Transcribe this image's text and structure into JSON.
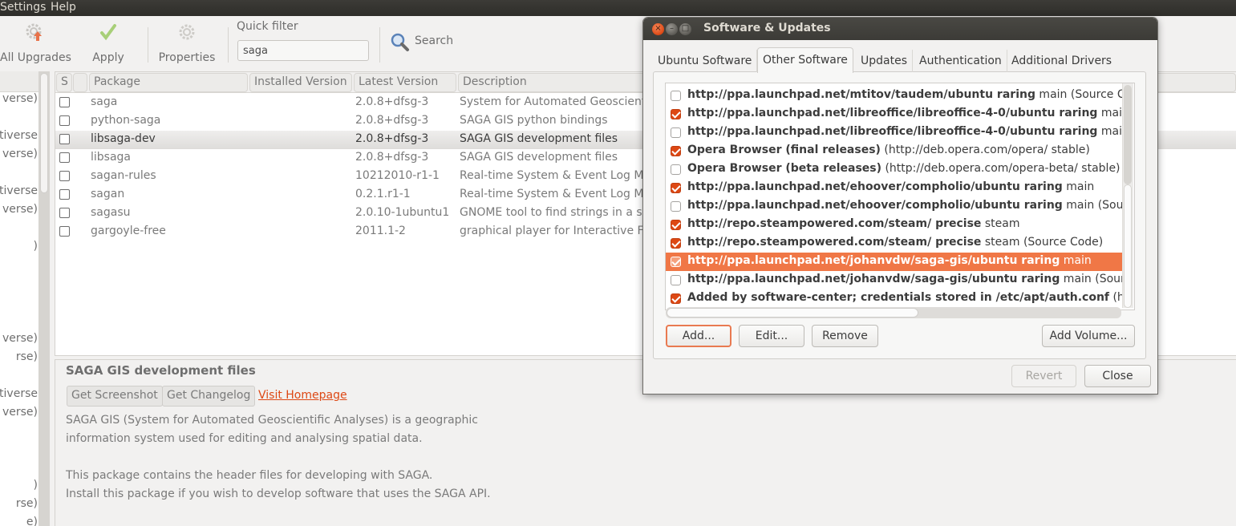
{
  "menubar": {
    "items": [
      "Settings",
      "Help"
    ]
  },
  "toolbar": {
    "all_upgrades": "All Upgrades",
    "apply": "Apply",
    "properties": "Properties",
    "quick_filter_label": "Quick filter",
    "quick_filter_value": "saga",
    "search": "Search"
  },
  "sidebar": {
    "items": [
      "verse)",
      "ltiverse",
      "verse)",
      "ltiverse",
      "verse)",
      ")",
      "verse)",
      "rse)",
      "ltiverse",
      "verse)",
      ")",
      "rse)",
      "e)"
    ]
  },
  "package_table": {
    "columns": [
      "S",
      "",
      "Package",
      "Installed Version",
      "Latest Version",
      "Description"
    ],
    "rows": [
      {
        "checked": false,
        "package": "saga",
        "installed": "",
        "latest": "2.0.8+dfsg-3",
        "description": "System for Automated Geoscientific Analyses"
      },
      {
        "checked": false,
        "package": "python-saga",
        "installed": "",
        "latest": "2.0.8+dfsg-3",
        "description": "SAGA GIS python bindings"
      },
      {
        "checked": false,
        "package": "libsaga-dev",
        "installed": "",
        "latest": "2.0.8+dfsg-3",
        "description": "SAGA GIS development files",
        "selected": true
      },
      {
        "checked": false,
        "package": "libsaga",
        "installed": "",
        "latest": "2.0.8+dfsg-3",
        "description": "SAGA GIS development files"
      },
      {
        "checked": false,
        "package": "sagan-rules",
        "installed": "",
        "latest": "10212010-r1-1",
        "description": "Real-time System & Event Log Monitoring"
      },
      {
        "checked": false,
        "package": "sagan",
        "installed": "",
        "latest": "0.2.1.r1-1",
        "description": "Real-time System & Event Log Monitoring"
      },
      {
        "checked": false,
        "package": "sagasu",
        "installed": "",
        "latest": "2.0.10-1ubuntu1",
        "description": "GNOME tool to find strings in a set of files"
      },
      {
        "checked": false,
        "package": "gargoyle-free",
        "installed": "",
        "latest": "2011.1-2",
        "description": "graphical player for Interactive Fiction"
      }
    ]
  },
  "details": {
    "title": "SAGA GIS development files",
    "get_screenshot": "Get Screenshot",
    "get_changelog": "Get Changelog",
    "visit_homepage": "Visit Homepage",
    "paragraphs": [
      "SAGA GIS (System for Automated Geoscientific Analyses) is a geographic",
      "information system used for editing and analysing spatial data.",
      "",
      "This package contains the header files for developing with SAGA.",
      "Install this package if you wish to develop software that uses the SAGA API."
    ]
  },
  "dialog": {
    "title": "Software & Updates",
    "tabs": [
      "Ubuntu Software",
      "Other Software",
      "Updates",
      "Authentication",
      "Additional Drivers"
    ],
    "active_tab": "Other Software",
    "sources": [
      {
        "checked": false,
        "bold": "http://ppa.launchpad.net/mtitov/taudem/ubuntu raring",
        "rest": " main (Source Code)"
      },
      {
        "checked": true,
        "bold": "http://ppa.launchpad.net/libreoffice/libreoffice-4-0/ubuntu raring",
        "rest": " main"
      },
      {
        "checked": false,
        "bold": "http://ppa.launchpad.net/libreoffice/libreoffice-4-0/ubuntu raring",
        "rest": " main (Source Code)"
      },
      {
        "checked": true,
        "bold": "Opera Browser (final releases)",
        "rest": " (http://deb.opera.com/opera/ stable)"
      },
      {
        "checked": false,
        "bold": "Opera Browser (beta releases)",
        "rest": " (http://deb.opera.com/opera-beta/ stable)"
      },
      {
        "checked": true,
        "bold": "http://ppa.launchpad.net/ehoover/compholio/ubuntu raring",
        "rest": " main"
      },
      {
        "checked": false,
        "bold": "http://ppa.launchpad.net/ehoover/compholio/ubuntu raring",
        "rest": " main (Source Code)"
      },
      {
        "checked": true,
        "bold": "http://repo.steampowered.com/steam/ precise",
        "rest": " steam"
      },
      {
        "checked": true,
        "bold": "http://repo.steampowered.com/steam/ precise",
        "rest": " steam (Source Code)"
      },
      {
        "checked": true,
        "bold": "http://ppa.launchpad.net/johanvdw/saga-gis/ubuntu raring",
        "rest": " main",
        "selected": true
      },
      {
        "checked": false,
        "bold": "http://ppa.launchpad.net/johanvdw/saga-gis/ubuntu raring",
        "rest": " main (Source Code)"
      },
      {
        "checked": true,
        "bold": "Added by software-center; credentials stored in /etc/apt/auth.conf",
        "rest": " (https://p"
      }
    ],
    "buttons": {
      "add": "Add...",
      "edit": "Edit...",
      "remove": "Remove",
      "add_volume": "Add Volume...",
      "revert": "Revert",
      "close": "Close"
    },
    "accent_color": "#dd4814",
    "selection_color": "#f07746"
  }
}
